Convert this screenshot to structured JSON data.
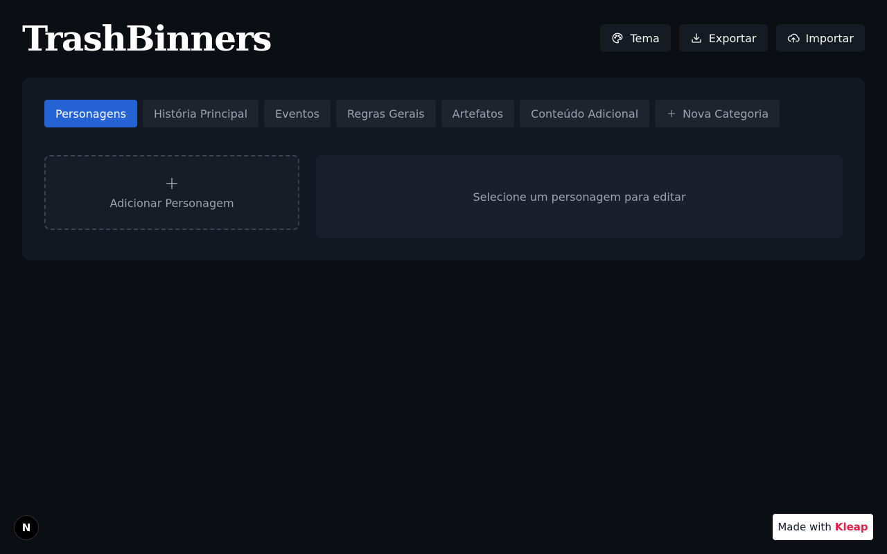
{
  "header": {
    "title": "TrashBinners",
    "actions": [
      {
        "label": "Tema",
        "icon": "palette-icon"
      },
      {
        "label": "Exportar",
        "icon": "download-icon"
      },
      {
        "label": "Importar",
        "icon": "upload-cloud-icon"
      }
    ]
  },
  "tabs": [
    {
      "label": "Personagens",
      "active": true
    },
    {
      "label": "História Principal",
      "active": false
    },
    {
      "label": "Eventos",
      "active": false
    },
    {
      "label": "Regras Gerais",
      "active": false
    },
    {
      "label": "Artefatos",
      "active": false
    },
    {
      "label": "Conteúdo Adicional",
      "active": false
    },
    {
      "label": "Nova Categoria",
      "active": false,
      "icon": "plus-icon"
    }
  ],
  "content": {
    "add_card_label": "Adicionar Personagem",
    "editor_placeholder": "Selecione um personagem para editar"
  },
  "footer": {
    "badge_letter": "N",
    "made_with_prefix": "Made with",
    "made_with_brand": "Kleap"
  },
  "colors": {
    "background": "#0b0e12",
    "panel": "#141823",
    "accent": "#2563d4",
    "brand": "#e11d48"
  }
}
